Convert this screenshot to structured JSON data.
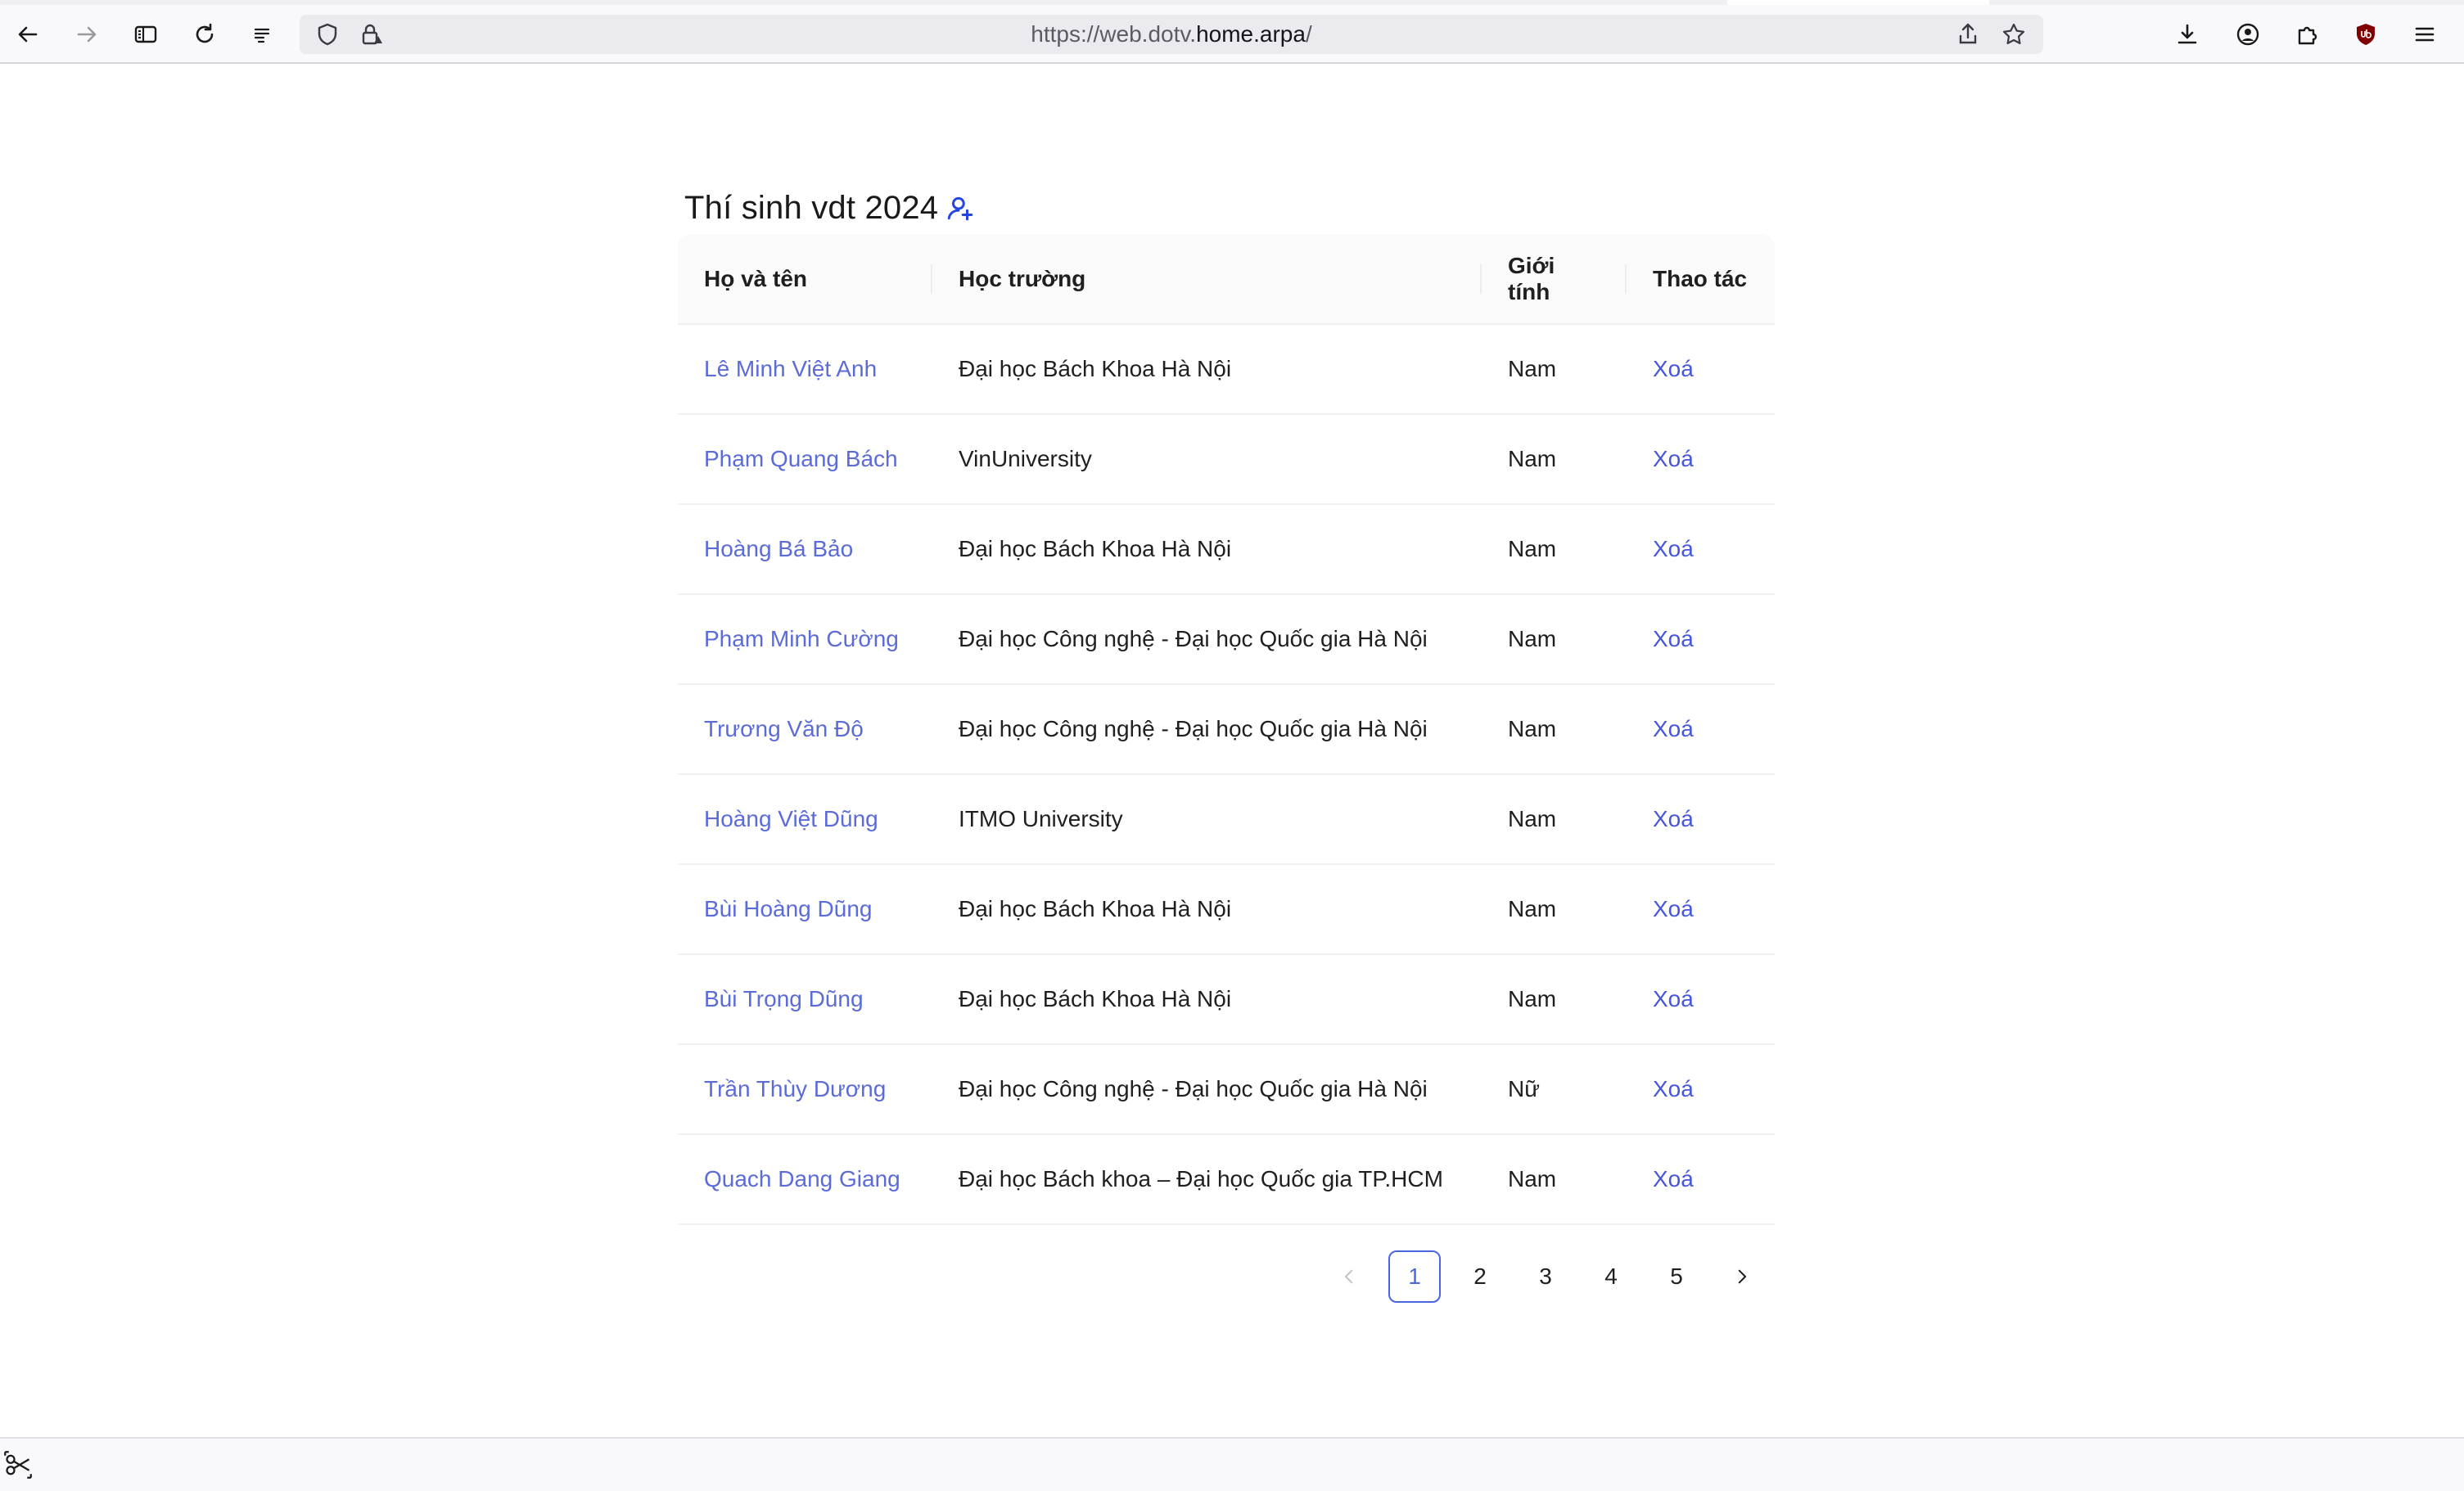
{
  "browser": {
    "url_prefix": "https://web.dotv.",
    "url_host": "home.arpa",
    "url_suffix": "/"
  },
  "page": {
    "title": "Thí sinh vdt 2024"
  },
  "table": {
    "headers": {
      "name": "Họ và tên",
      "school": "Học trường",
      "gender": "Giới tính",
      "action": "Thao tác"
    },
    "rows": [
      {
        "name": "Lê Minh Việt Anh",
        "school": "Đại học Bách Khoa Hà Nội",
        "gender": "Nam",
        "action": "Xoá"
      },
      {
        "name": "Phạm Quang Bách",
        "school": "VinUniversity",
        "gender": "Nam",
        "action": "Xoá"
      },
      {
        "name": "Hoàng Bá Bảo",
        "school": "Đại học Bách Khoa Hà Nội",
        "gender": "Nam",
        "action": "Xoá"
      },
      {
        "name": "Phạm Minh Cường",
        "school": "Đại học Công nghệ - Đại học Quốc gia Hà Nội",
        "gender": "Nam",
        "action": "Xoá"
      },
      {
        "name": "Trương Văn Độ",
        "school": "Đại học Công nghệ - Đại học Quốc gia Hà Nội",
        "gender": "Nam",
        "action": "Xoá"
      },
      {
        "name": "Hoàng Việt Dũng",
        "school": "ITMO University",
        "gender": "Nam",
        "action": "Xoá"
      },
      {
        "name": "Bùi Hoàng Dũng",
        "school": "Đại học Bách Khoa Hà Nội",
        "gender": "Nam",
        "action": "Xoá"
      },
      {
        "name": "Bùi Trọng Dũng",
        "school": "Đại học Bách Khoa Hà Nội",
        "gender": "Nam",
        "action": "Xoá"
      },
      {
        "name": "Trần Thùy Dương",
        "school": "Đại học Công nghệ - Đại học Quốc gia Hà Nội",
        "gender": "Nữ",
        "action": "Xoá"
      },
      {
        "name": "Quach Dang Giang",
        "school": "Đại học Bách khoa – Đại học Quốc gia TP.HCM",
        "gender": "Nam",
        "action": "Xoá"
      }
    ]
  },
  "pagination": {
    "pages": [
      "1",
      "2",
      "3",
      "4",
      "5"
    ],
    "current": "1"
  },
  "colors": {
    "link": "#5b6bd8",
    "accent": "#4a67e0"
  }
}
